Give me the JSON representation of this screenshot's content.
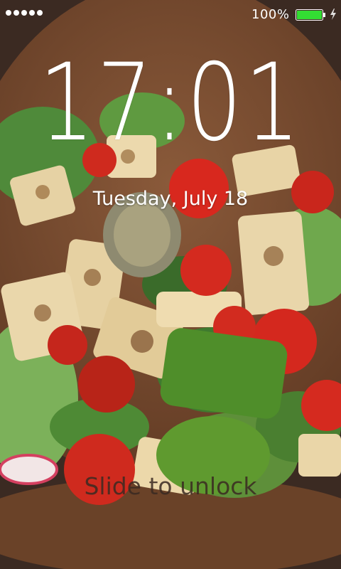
{
  "status_bar": {
    "battery_percent": "100%",
    "battery_level": 1.0,
    "signal_dots": 5,
    "charging": true
  },
  "lock_screen": {
    "time": "17:01",
    "date": "Tuesday, July 18",
    "unlock_hint": "Slide to unlock"
  },
  "colors": {
    "battery_fill": "#33dd33",
    "text": "#ffffff"
  }
}
